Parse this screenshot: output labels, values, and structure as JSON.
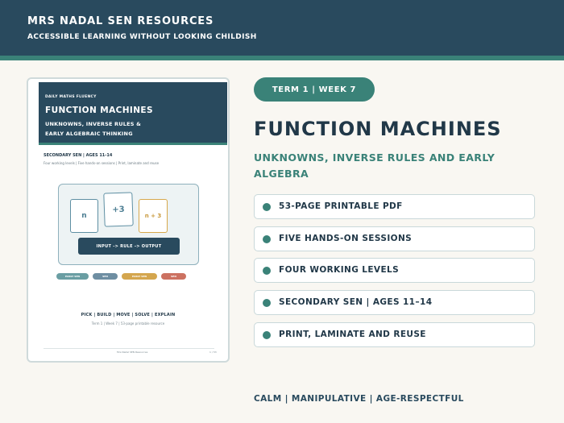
{
  "brand": {
    "name": "MRS NADAL SEN RESOURCES",
    "tagline": "ACCESSIBLE LEARNING WITHOUT LOOKING CHILDISH"
  },
  "cover": {
    "kicker": "DAILY MATHS FLUENCY",
    "title": "FUNCTION MACHINES",
    "subtitle_line1": "UNKNOWNS, INVERSE RULES &",
    "subtitle_line2": "EARLY ALGEBRAIC THINKING",
    "audience": "SECONDARY SEN  |  AGES 11-14",
    "detail": "Four working levels  |  Five hands-on sessions  |  Print, laminate and reuse",
    "cards": [
      "n",
      "+3",
      "n + 3"
    ],
    "machine_label": "INPUT  ->  RULE  ->  OUTPUT",
    "levels": [
      "EARLY SEN",
      "SEN",
      "EARLY SEN",
      "SEN"
    ],
    "actions": "PICK  |  BUILD  |  MOVE  |  SOLVE  |  EXPLAIN",
    "meta": "Term 1  |  Week 7  |  53-page printable resource",
    "footer": "Mrs Nadal SEN Resources",
    "page": "1 / 53"
  },
  "term_badge": "TERM 1  |  WEEK 7",
  "title": "FUNCTION MACHINES",
  "subtitle": "UNKNOWNS, INVERSE RULES AND EARLY ALGEBRA",
  "features": [
    "53-PAGE PRINTABLE PDF",
    "FIVE HANDS-ON SESSIONS",
    "FOUR WORKING LEVELS",
    "SECONDARY SEN  |  AGES 11–14",
    "PRINT, LAMINATE AND REUSE"
  ],
  "footer_tagline": "CALM  |  MANIPULATIVE  |  AGE-RESPECTFUL",
  "colors": {
    "navy": "#294a5e",
    "teal": "#3a8278",
    "background": "#f9f7f2",
    "gold": "#d4a64e",
    "coral": "#cc7161"
  }
}
